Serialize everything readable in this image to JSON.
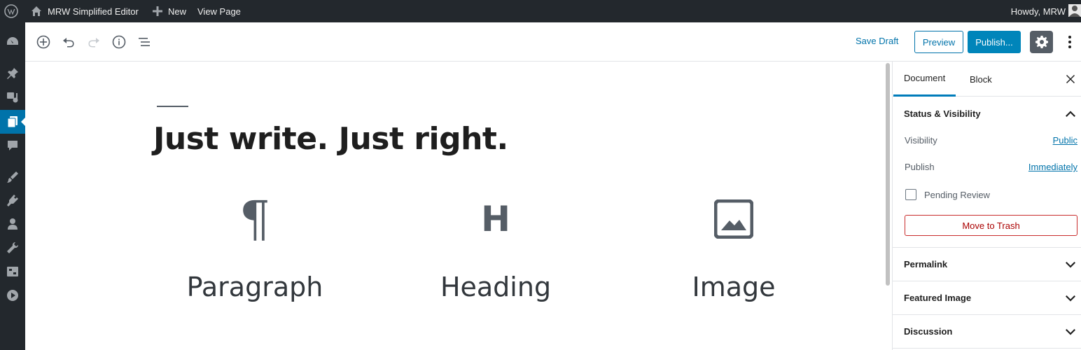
{
  "admin_bar": {
    "site_name": "MRW Simplified Editor",
    "new_label": "New",
    "view_label": "View Page",
    "greeting": "Howdy, MRW"
  },
  "admin_menu": {
    "items": [
      {
        "icon": "dashboard-icon"
      },
      {
        "icon": "pin-icon"
      },
      {
        "icon": "media-icon"
      },
      {
        "icon": "pages-icon",
        "current": true
      },
      {
        "icon": "comments-icon"
      },
      {
        "icon": "appearance-icon"
      },
      {
        "icon": "plugins-icon"
      },
      {
        "icon": "users-icon"
      },
      {
        "icon": "tools-icon"
      },
      {
        "icon": "settings-icon"
      },
      {
        "icon": "media-play-icon"
      }
    ]
  },
  "toolbar": {
    "save_draft": "Save Draft",
    "preview": "Preview",
    "publish": "Publish..."
  },
  "editor": {
    "title": "Just write. Just right.",
    "blocks": [
      {
        "label": "Paragraph",
        "icon": "paragraph-icon"
      },
      {
        "label": "Heading",
        "icon": "heading-icon"
      },
      {
        "label": "Image",
        "icon": "image-icon"
      }
    ]
  },
  "sidebar": {
    "tabs": [
      "Document",
      "Block"
    ],
    "active_tab": "Document",
    "status_panel": {
      "title": "Status & Visibility",
      "visibility_label": "Visibility",
      "visibility_value": "Public",
      "publish_label": "Publish",
      "publish_value": "Immediately",
      "pending_review": "Pending Review",
      "trash": "Move to Trash"
    },
    "panels": [
      "Permalink",
      "Featured Image",
      "Discussion"
    ]
  },
  "colors": {
    "admin_dark": "#23282d",
    "accent": "#0073aa",
    "publish_bg": "#0085ba",
    "danger": "#a00"
  }
}
